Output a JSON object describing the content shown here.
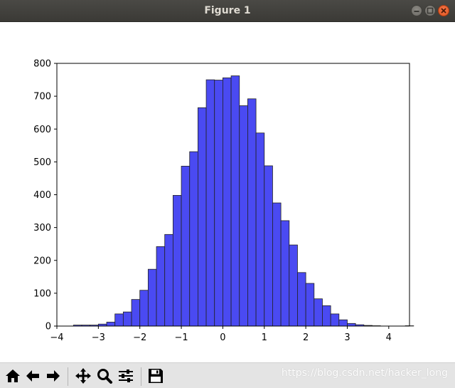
{
  "window": {
    "title": "Figure 1"
  },
  "toolbar": {
    "buttons": [
      "home-icon",
      "back-arrow-icon",
      "forward-arrow-icon",
      "pan-icon",
      "zoom-icon",
      "configure-subplots-icon",
      "save-icon"
    ],
    "watermark": "https://blog.csdn.net/hacker_long"
  },
  "colors": {
    "bar_fill": "#4a4af2",
    "bar_edge": "#222222",
    "titlebar": "#3f3e3a"
  },
  "chart_data": {
    "type": "bar",
    "title": "",
    "xlabel": "",
    "ylabel": "",
    "xlim": [
      -4,
      4.5
    ],
    "ylim": [
      0,
      800
    ],
    "xticks": [
      -4,
      -3,
      -2,
      -1,
      0,
      1,
      2,
      3,
      4
    ],
    "xtick_labels": [
      "−4",
      "−3",
      "−2",
      "−1",
      "0",
      "1",
      "2",
      "3",
      "4"
    ],
    "yticks": [
      0,
      100,
      200,
      300,
      400,
      500,
      600,
      700,
      800
    ],
    "ytick_labels": [
      "0",
      "100",
      "200",
      "300",
      "400",
      "500",
      "600",
      "700",
      "800"
    ],
    "bin_start": -3.6,
    "bin_width": 0.2,
    "values": [
      3,
      3,
      3,
      6,
      12,
      37,
      43,
      81,
      109,
      173,
      242,
      279,
      398,
      487,
      531,
      665,
      750,
      749,
      756,
      762,
      671,
      692,
      588,
      488,
      375,
      321,
      247,
      163,
      130,
      83,
      62,
      37,
      19,
      8,
      4,
      2,
      1,
      0,
      0,
      0,
      1
    ],
    "grid": false,
    "legend": "none"
  }
}
